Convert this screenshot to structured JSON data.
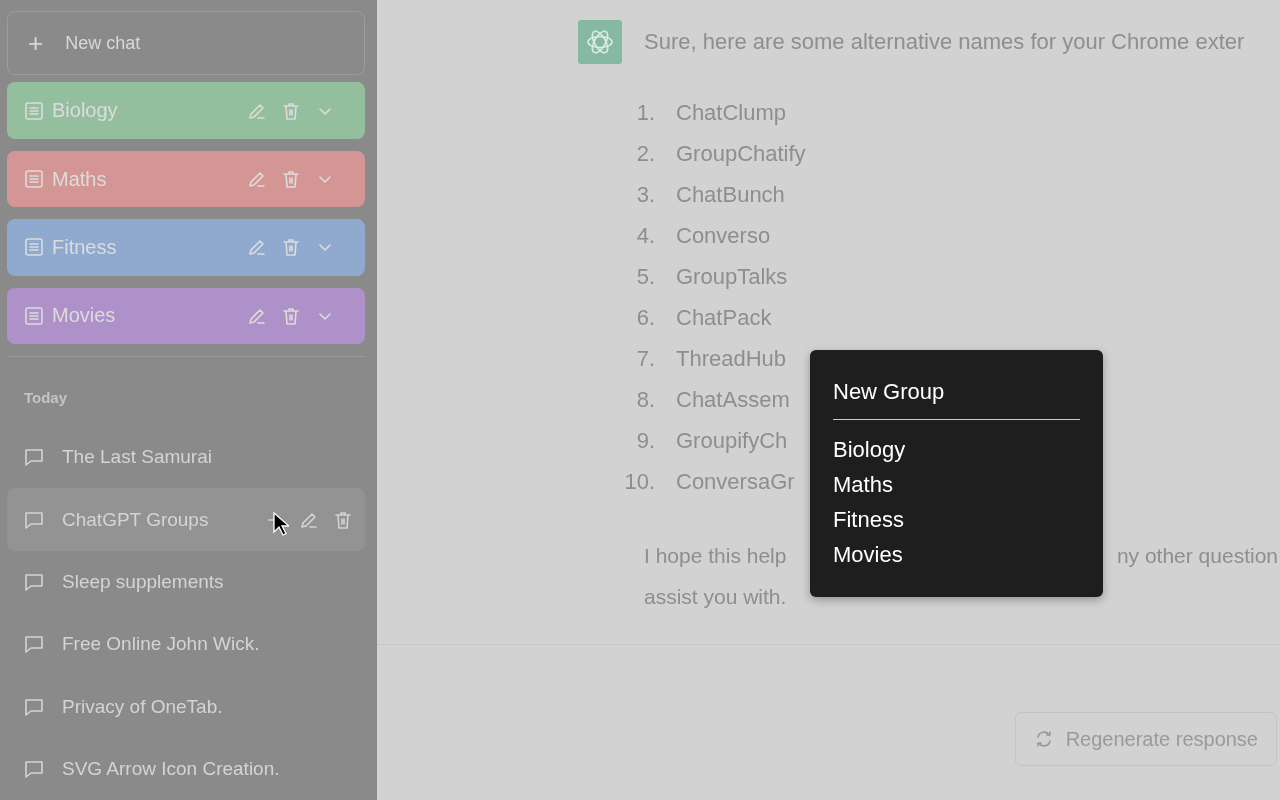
{
  "sidebar": {
    "new_chat": {
      "icon": "+",
      "label": "New chat"
    },
    "groups": [
      {
        "name": "Biology",
        "color": "#93bf9f"
      },
      {
        "name": "Maths",
        "color": "#d49595"
      },
      {
        "name": "Fitness",
        "color": "#8fa9cf"
      },
      {
        "name": "Movies",
        "color": "#ae91c9"
      }
    ],
    "section": "Today",
    "chats": [
      {
        "title": "The Last Samurai",
        "selected": false
      },
      {
        "title": "ChatGPT Groups",
        "selected": true
      },
      {
        "title": "Sleep supplements",
        "selected": false
      },
      {
        "title": "Free Online John Wick.",
        "selected": false
      },
      {
        "title": "Privacy of OneTab.",
        "selected": false
      },
      {
        "title": "SVG Arrow Icon Creation.",
        "selected": false
      }
    ]
  },
  "message": {
    "intro": "Sure, here are some alternative names for your Chrome exter",
    "list": [
      {
        "number": "1.",
        "text": "ChatClump"
      },
      {
        "number": "2.",
        "text": "GroupChatify"
      },
      {
        "number": "3.",
        "text": "ChatBunch"
      },
      {
        "number": "4.",
        "text": "Converso"
      },
      {
        "number": "5.",
        "text": "GroupTalks"
      },
      {
        "number": "6.",
        "text": "ChatPack"
      },
      {
        "number": "7.",
        "text": "ThreadHub"
      },
      {
        "number": "8.",
        "text": "ChatAssem"
      },
      {
        "number": "9.",
        "text": "GroupifyCh"
      },
      {
        "number": "10.",
        "text": "ConversaGr"
      }
    ],
    "closing_left": "I hope this help",
    "closing_right": "ny other question",
    "closing_line2": "assist you with."
  },
  "regenerate": "Regenerate response",
  "group_menu": {
    "new_group": "New Group",
    "groups": [
      "Biology",
      "Maths",
      "Fitness",
      "Movies"
    ]
  }
}
